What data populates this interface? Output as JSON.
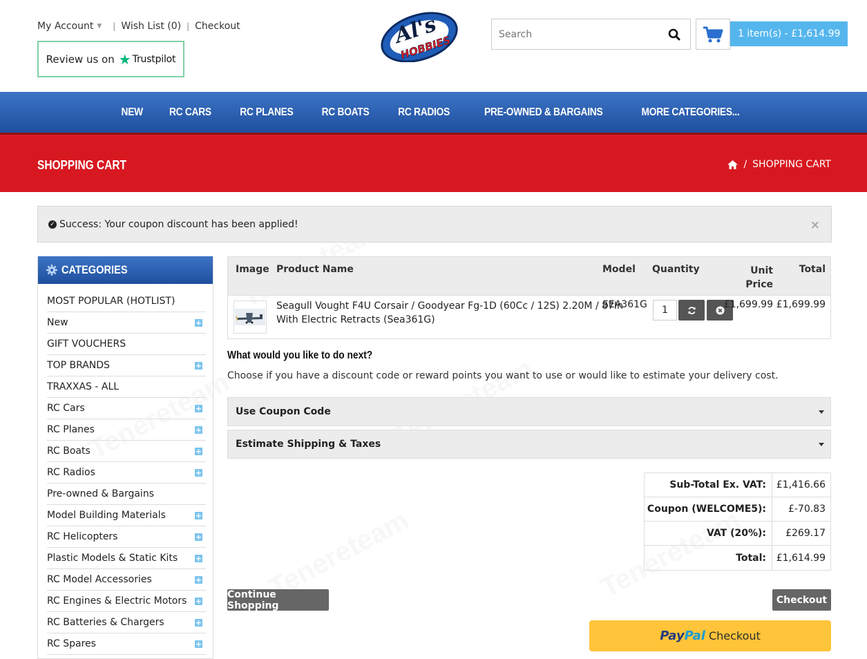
{
  "header": {
    "my_account": "My Account",
    "wish_list": "Wish List (0)",
    "checkout": "Checkout",
    "trustpilot_prefix": "Review us on",
    "trustpilot_brand": "Trustpilot",
    "logo_top": "Al's",
    "logo_bottom": "HOBBIES",
    "search_placeholder": "Search",
    "cart_total": "1 item(s) - £1,614.99"
  },
  "nav": {
    "items": [
      "NEW",
      "RC CARS",
      "RC PLANES",
      "RC BOATS",
      "RC RADIOS",
      "PRE-OWNED & BARGAINS",
      "MORE CATEGORIES..."
    ]
  },
  "banner": {
    "title": "SHOPPING CART",
    "breadcrumb": "SHOPPING CART"
  },
  "alert": {
    "message": "Success: Your coupon discount has been applied!",
    "close": "×"
  },
  "sidebar": {
    "title": "CATEGORIES",
    "items": [
      {
        "label": "MOST POPULAR (HOTLIST)",
        "expandable": false
      },
      {
        "label": "New",
        "expandable": true
      },
      {
        "label": "GIFT VOUCHERS",
        "expandable": false
      },
      {
        "label": "TOP BRANDS",
        "expandable": true
      },
      {
        "label": "TRAXXAS - ALL",
        "expandable": false
      },
      {
        "label": "RC Cars",
        "expandable": true
      },
      {
        "label": "RC Planes",
        "expandable": true
      },
      {
        "label": "RC Boats",
        "expandable": true
      },
      {
        "label": "RC Radios",
        "expandable": true
      },
      {
        "label": "Pre-owned & Bargains",
        "expandable": false
      },
      {
        "label": "Model Building Materials",
        "expandable": true
      },
      {
        "label": "RC Helicopters",
        "expandable": true
      },
      {
        "label": "Plastic Models & Static Kits",
        "expandable": true
      },
      {
        "label": "RC Model Accessories",
        "expandable": true
      },
      {
        "label": "RC Engines & Electric Motors",
        "expandable": true
      },
      {
        "label": "RC Batteries & Chargers",
        "expandable": true
      },
      {
        "label": "RC Spares",
        "expandable": true
      }
    ]
  },
  "cart_table": {
    "headers": {
      "image": "Image",
      "product_name": "Product Name",
      "model": "Model",
      "quantity": "Quantity",
      "unit_price_1": "Unit",
      "unit_price_2": "Price",
      "total": "Total"
    },
    "row": {
      "name_line1": "Seagull Vought F4U Corsair / Goodyear Fg-1D (60Cc / 12S) 2.20M / 87In",
      "name_line2": "With Electric Retracts (Sea361G)",
      "model": "SEA361G",
      "quantity": "1",
      "unit_price": "£1,699.99",
      "total": "£1,699.99"
    }
  },
  "next": {
    "heading": "What would you like to do next?",
    "text": "Choose if you have a discount code or reward points you want to use or would like to estimate your delivery cost."
  },
  "accordions": {
    "coupon": "Use Coupon Code",
    "shipping": "Estimate Shipping & Taxes"
  },
  "totals": [
    {
      "label": "Sub-Total Ex. VAT:",
      "value": "£1,416.66"
    },
    {
      "label": "Coupon (WELCOME5):",
      "value": "£-70.83"
    },
    {
      "label": "VAT (20%):",
      "value": "£269.17"
    },
    {
      "label": "Total:",
      "value": "£1,614.99"
    }
  ],
  "buttons": {
    "continue": "Continue Shopping",
    "checkout": "Checkout",
    "paypal_pay": "Pay",
    "paypal_pal": "Pal",
    "paypal_checkout": "Checkout"
  },
  "colors": {
    "nav_blue": "#2b5fb3",
    "banner_red": "#d81820",
    "cart_blue": "#55b6ee",
    "paypal_yellow": "#ffc439"
  },
  "watermark": "Tenereteam"
}
